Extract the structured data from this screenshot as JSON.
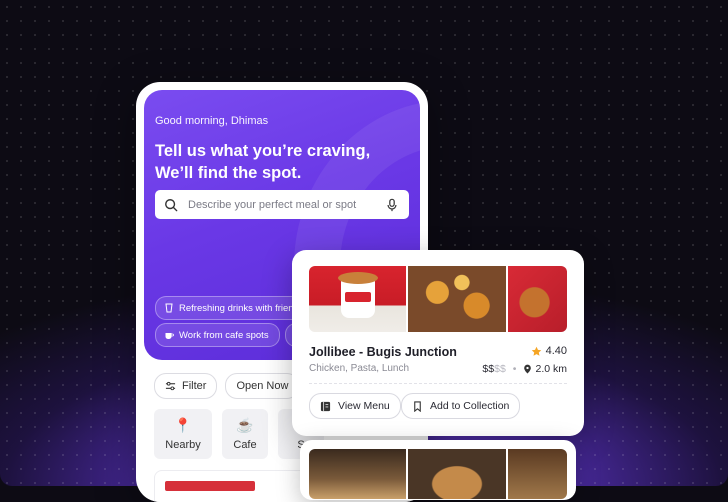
{
  "hero": {
    "greeting": "Good morning, Dhimas",
    "headline_line1": "Tell us what you’re craving,",
    "headline_line2": "We’ll find the spot.",
    "search_placeholder": "Describe your perfect meal or spot",
    "suggestions": [
      "Refreshing drinks with friends",
      "Work from cafe spots"
    ]
  },
  "filters": [
    "Filter",
    "Open Now"
  ],
  "categories": [
    "Nearby",
    "Cafe",
    "S"
  ],
  "restaurant": {
    "name": "Jollibee - Bugis Junction",
    "rating": "4.40",
    "tags": "Chicken, Pasta, Lunch",
    "price_active": "$$",
    "price_inactive": "$$",
    "separator": "•",
    "distance": "2.0 km",
    "view_menu": "View Menu",
    "add_collection": "Add to Collection"
  },
  "colors": {
    "brand_purple": "#6a38e6",
    "star": "#f5a524",
    "background": "#0d0b14"
  },
  "icons": [
    "search-icon",
    "mic-icon",
    "filter-icon",
    "star-icon",
    "pin-icon",
    "menu-icon",
    "bookmark-icon"
  ]
}
